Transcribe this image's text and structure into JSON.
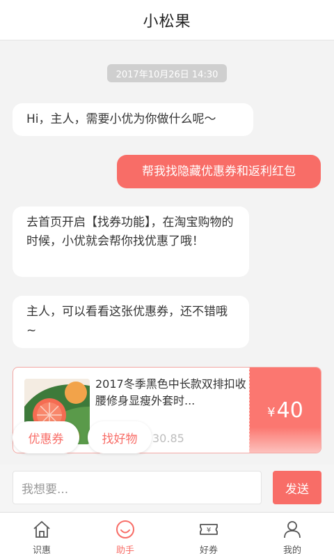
{
  "header": {
    "title": "小松果"
  },
  "chat": {
    "timestamp": "2017年10月26日 14:30",
    "messages": [
      {
        "from": "bot",
        "text": "Hi，主人，需要小优为你做什么呢～"
      },
      {
        "from": "user",
        "text": "帮我找隐藏优惠券和返利红包"
      },
      {
        "from": "bot",
        "text": "去首页开启【找券功能】，在淘宝购物的时候，小优就会帮你找优惠了哦！"
      },
      {
        "from": "bot",
        "text": "主人，可以看看这张优惠券，还不错哦~"
      }
    ]
  },
  "coupon": {
    "title": "2017冬季黑色中长款双排扣收腰修身显瘦外套时...",
    "price": "30.85",
    "currency": "¥",
    "amount": "40"
  },
  "quick_actions": [
    {
      "label": "优惠券"
    },
    {
      "label": "找好物"
    }
  ],
  "input": {
    "placeholder": "我想要...",
    "send_label": "发送"
  },
  "tabbar": {
    "items": [
      {
        "label": "识惠",
        "icon": "home-icon"
      },
      {
        "label": "助手",
        "icon": "smile-icon",
        "active": true
      },
      {
        "label": "好券",
        "icon": "ticket-icon"
      },
      {
        "label": "我的",
        "icon": "user-icon"
      }
    ]
  },
  "colors": {
    "accent": "#f86d67",
    "background": "#f3f3f3"
  }
}
